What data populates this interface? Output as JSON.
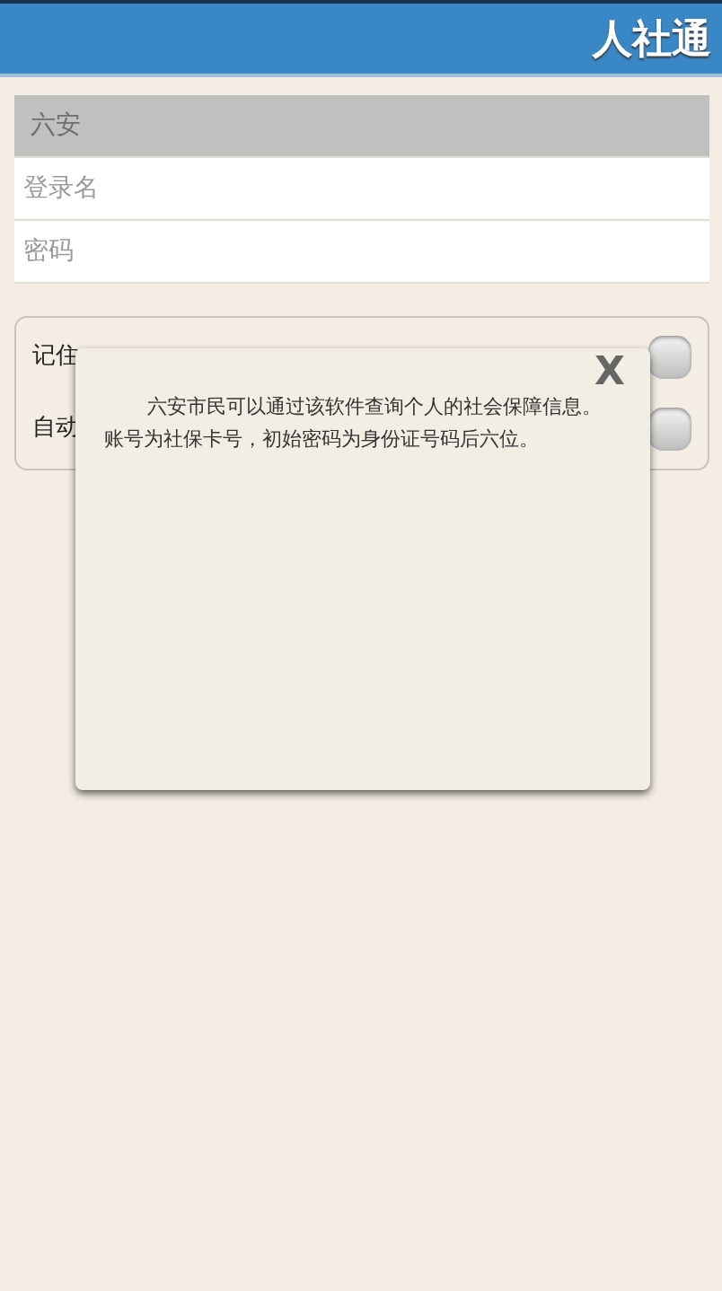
{
  "header": {
    "title": "人社通"
  },
  "fields": [
    {
      "kind": "select",
      "value": "六安"
    },
    {
      "kind": "text",
      "placeholder": "登录名"
    },
    {
      "kind": "password",
      "placeholder": "密码"
    }
  ],
  "options": [
    {
      "label": "记住",
      "on": false
    },
    {
      "label": "自动",
      "on": false
    }
  ],
  "dialog": {
    "close": "X",
    "message": "六安市民可以通过该软件查询个人的社会保障信息。账号为社保卡号，初始密码为身份证号码后六位。"
  }
}
